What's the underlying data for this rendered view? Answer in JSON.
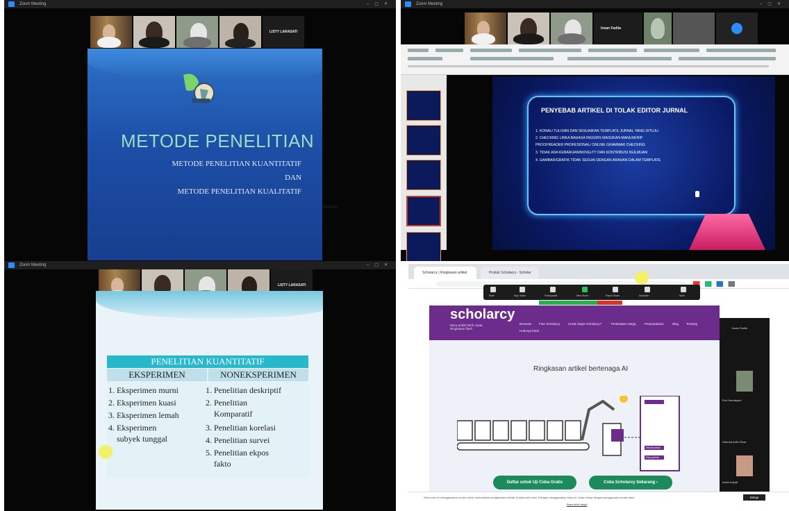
{
  "q1": {
    "window_title": "Zoom Meeting",
    "tile_name": "LISTY LARASATI",
    "slide": {
      "title": "METODE PENELITIAN",
      "line1": "METODE PENELITIAN KUANTITATIF",
      "line2": "DAN",
      "line3": "METODE PENELITIAN KUALITATIF"
    }
  },
  "q2": {
    "window_title": "Zoom Meeting",
    "tile_name": "Irwan Fadila",
    "slide": {
      "title": "PENYEBAB ARTIKEL DI TOLAK EDITOR JURNAL",
      "items": [
        "1.  KONALI TULISAN DAN SESUAIKAN TEMPLATE JURNAL YANG DITUJU",
        "2.  CHECKING LINKA BAHASA INGGRIS MASUKAN MANUSKRIP",
        "     PROOFREADER PROFESIONAL/ ONLINE GRAMMAR CHECKING",
        "3.  TIDAK ADA KEBARUAN/NOVELTY DAN KONTRIBUSI KEILMUAN",
        "4.  GAMBAR/GRAFIK TIDAK SESUAI DENGAN ARAHAN DALAM TEMPLATE"
      ]
    }
  },
  "q3": {
    "window_title": "Zoom Meeting",
    "tile_name": "LISTY LARASATI",
    "table": {
      "header": "PENELITIAN  KUANTITATIF",
      "col1": "EKSPERIMEN",
      "col2": "NONEKSPERIMEN",
      "left": [
        "1. Eksperimen murni",
        "2. Eksperimen kuasi",
        "3. Eksperimen lemah",
        "4. Eksperimen",
        "    subyek tunggal"
      ],
      "right": [
        "1. Penelitian deskriptif",
        "2. Penelitian",
        "    Komparatif",
        "3. Penelitian korelasi",
        "4. Penelitian survei",
        "5. Penelitian ekpos",
        "    fakto"
      ]
    }
  },
  "q4": {
    "tabs": [
      "Scholarcy | Ringkasan artikel",
      "Produk Scholarcy - Scholar"
    ],
    "logo": "scholarcy",
    "tagline": "Baca artikel lebih cepat. Ringkasan flash",
    "nav_links": [
      "Beranda",
      "Fitur Scholarcy",
      "Untuk Siapa Scholarcy?",
      "Perbedaan Harga",
      "Perpustakaan",
      "Blog",
      "Tentang",
      "Hubungi Kami"
    ],
    "hero_title": "Ringkasan artikel bertenaga AI",
    "cta_left": "Daftar untuk Uji Coba Gratis",
    "cta_right": "Coba Scholarcy Sekarang  ›",
    "side_panel_name": "Irwan Fadila",
    "side_panel_people": [
      "Erni Handayani",
      "Rahmat Arifin Rizal",
      "Indah Ariyati"
    ],
    "cookie_text": "Situs web ini menggunakan cookie untuk memastikan pengalaman terbaik di situs web kami. Dengan menggunakan situs ini, Anda setuju dengan penggunaan cookie kami.",
    "cookie_btn": "Setuju",
    "cookie_link": "Baca lebih lanjut",
    "panel_labels": [
      "Summary",
      "Introduction",
      "Key points"
    ],
    "zoom_controls": [
      "Mute",
      "Stop Video",
      "Participants",
      "New Share",
      "Pause Share",
      "Annotate",
      "More"
    ]
  }
}
